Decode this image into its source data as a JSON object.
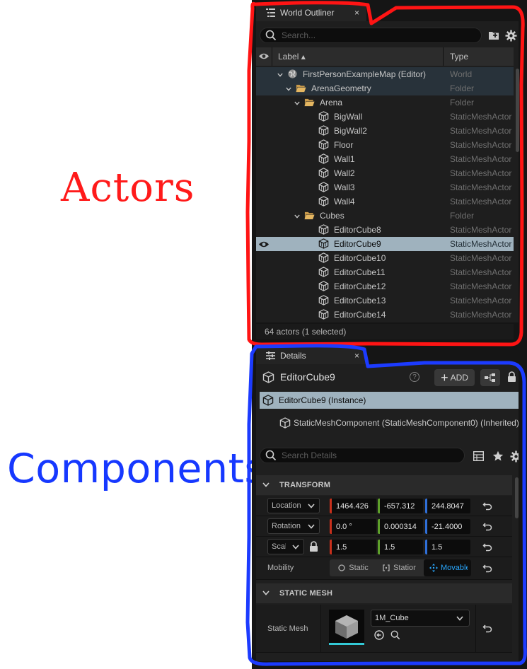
{
  "annotations": {
    "actors": "Actors",
    "components": "Components"
  },
  "outliner": {
    "tab_title": "World Outliner",
    "tab_close": "×",
    "search_placeholder": "Search...",
    "col_label": "Label ▴",
    "col_type": "Type",
    "rows": [
      {
        "name": "FirstPersonExampleMap (Editor)",
        "type": "World",
        "icon": "globe-icon",
        "level": 0
      },
      {
        "name": "ArenaGeometry",
        "type": "Folder",
        "icon": "folder-open-icon",
        "level": 1
      },
      {
        "name": "Arena",
        "type": "Folder",
        "icon": "folder-open-icon",
        "level": 2
      },
      {
        "name": "BigWall",
        "type": "StaticMeshActor",
        "icon": "static-mesh-icon",
        "level": 3
      },
      {
        "name": "BigWall2",
        "type": "StaticMeshActor",
        "icon": "static-mesh-icon",
        "level": 3
      },
      {
        "name": "Floor",
        "type": "StaticMeshActor",
        "icon": "static-mesh-icon",
        "level": 3
      },
      {
        "name": "Wall1",
        "type": "StaticMeshActor",
        "icon": "static-mesh-icon",
        "level": 3
      },
      {
        "name": "Wall2",
        "type": "StaticMeshActor",
        "icon": "static-mesh-icon",
        "level": 3
      },
      {
        "name": "Wall3",
        "type": "StaticMeshActor",
        "icon": "static-mesh-icon",
        "level": 3
      },
      {
        "name": "Wall4",
        "type": "StaticMeshActor",
        "icon": "static-mesh-icon",
        "level": 3
      },
      {
        "name": "Cubes",
        "type": "Folder",
        "icon": "folder-open-icon",
        "level": 2
      },
      {
        "name": "EditorCube8",
        "type": "StaticMeshActor",
        "icon": "static-mesh-icon",
        "level": 3
      },
      {
        "name": "EditorCube9",
        "type": "StaticMeshActor",
        "icon": "static-mesh-icon",
        "level": 3,
        "selected": true
      },
      {
        "name": "EditorCube10",
        "type": "StaticMeshActor",
        "icon": "static-mesh-icon",
        "level": 3
      },
      {
        "name": "EditorCube11",
        "type": "StaticMeshActor",
        "icon": "static-mesh-icon",
        "level": 3
      },
      {
        "name": "EditorCube12",
        "type": "StaticMeshActor",
        "icon": "static-mesh-icon",
        "level": 3
      },
      {
        "name": "EditorCube13",
        "type": "StaticMeshActor",
        "icon": "static-mesh-icon",
        "level": 3
      },
      {
        "name": "EditorCube14",
        "type": "StaticMeshActor",
        "icon": "static-mesh-icon",
        "level": 3
      }
    ],
    "footer": "64 actors (1 selected)"
  },
  "details": {
    "tab_title": "Details",
    "tab_close": "×",
    "actor_name": "EditorCube9",
    "help": "?",
    "add_label": "ADD",
    "instance_label": "EditorCube9 (Instance)",
    "component_label": "StaticMeshComponent (StaticMeshComponent0) (Inherited)",
    "search_placeholder": "Search Details",
    "transform": {
      "section_title": "TRANSFORM",
      "location_label": "Location",
      "location": [
        "1464.426",
        "-657.312",
        "244.8047"
      ],
      "rotation_label": "Rotation",
      "rotation": [
        "0.0 °",
        "0.000314",
        "-21.4000"
      ],
      "scale_label": "Scale",
      "scale": [
        "1.5",
        "1.5",
        "1.5"
      ],
      "mobility_label": "Mobility",
      "mobility_options": [
        "Static",
        "Stationary",
        "Movable"
      ],
      "mobility_selected": "Movable"
    },
    "static_mesh": {
      "section_title": "STATIC MESH",
      "label": "Static Mesh",
      "value": "1M_Cube"
    }
  },
  "colors": {
    "annot_red": "#ff1a1a",
    "annot_blue": "#1638ff",
    "selection": "#9fb2be",
    "x_axis": "#c8301c",
    "y_axis": "#5ea02a",
    "z_axis": "#2f6fd8",
    "movable": "#29a8ff"
  }
}
